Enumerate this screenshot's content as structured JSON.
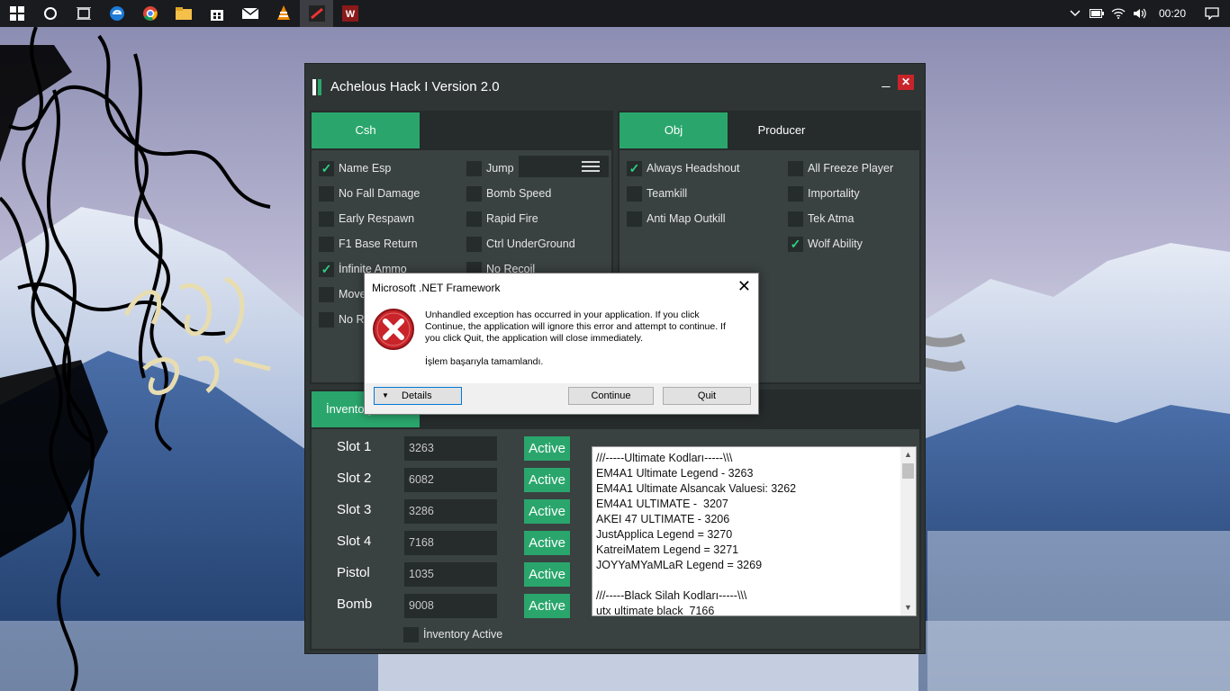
{
  "taskbar": {
    "icons": [
      "windows-start-icon",
      "cortana-icon",
      "task-view-icon",
      "edge-icon",
      "chrome-icon",
      "file-explorer-icon",
      "store-icon",
      "mail-icon",
      "vlc-icon",
      "app-icon",
      "hack-app-icon"
    ],
    "tray_icons": [
      "chevron-up-icon",
      "battery-icon",
      "wifi-icon",
      "volume-icon"
    ],
    "time": "00:20"
  },
  "hack_window": {
    "title": "Achelous Hack I Version 2.0",
    "minimize": "_",
    "close": "✕",
    "accent": "#2aa66c",
    "left_panel": {
      "tab": "Csh",
      "col1": [
        {
          "label": "Name Esp",
          "checked": true
        },
        {
          "label": "No Fall Damage",
          "checked": false
        },
        {
          "label": "Early Respawn",
          "checked": false
        },
        {
          "label": "F1 Base Return",
          "checked": false
        },
        {
          "label": "İnfinite Ammo",
          "checked": true
        },
        {
          "label": "Move",
          "checked": false
        },
        {
          "label": "No R",
          "checked": false
        }
      ],
      "col2": [
        {
          "label": "Jump",
          "checked": false
        },
        {
          "label": "Bomb Speed",
          "checked": false
        },
        {
          "label": "Rapid Fire",
          "checked": false
        },
        {
          "label": "Ctrl UnderGround",
          "checked": false
        },
        {
          "label": "No Recoil",
          "checked": false
        }
      ]
    },
    "right_panel": {
      "tabs": [
        "Obj",
        "Producer"
      ],
      "col1": [
        {
          "label": "Always Headshout",
          "checked": true
        },
        {
          "label": "Teamkill",
          "checked": false
        },
        {
          "label": "Anti Map Outkill",
          "checked": false
        }
      ],
      "col2": [
        {
          "label": "All Freeze Player",
          "checked": false
        },
        {
          "label": "Importality",
          "checked": false
        },
        {
          "label": "Tek Atma",
          "checked": false
        },
        {
          "label": "Wolf Ability",
          "checked": true
        }
      ]
    },
    "inventory": {
      "tab": "İnventory",
      "slots": [
        {
          "label": "Slot 1",
          "value": "3263",
          "button": "Active"
        },
        {
          "label": "Slot 2",
          "value": "6082",
          "button": "Active"
        },
        {
          "label": "Slot 3",
          "value": "3286",
          "button": "Active"
        },
        {
          "label": "Slot 4",
          "value": "7168",
          "button": "Active"
        },
        {
          "label": "Pistol",
          "value": "1035",
          "button": "Active"
        },
        {
          "label": "Bomb",
          "value": "9008",
          "button": "Active"
        }
      ],
      "inventory_active": "İnventory Active",
      "codes": [
        "///-----Ultimate Kodları-----\\\\\\",
        "EM4A1 Ultimate Legend - 3263",
        "EM4A1 Ultimate Alsancak Valuesi: 3262",
        "EM4A1 ULTIMATE -  3207",
        "AKEI 47 ULTIMATE - 3206",
        "JustApplica Legend = 3270",
        "KatreiMatem Legend = 3271",
        "JOYYaMYaMLaR Legend = 3269",
        "",
        "///-----Black Silah Kodları-----\\\\\\",
        "utx ultimate black  7166"
      ]
    }
  },
  "dialog": {
    "title": "Microsoft .NET Framework",
    "message": "Unhandled exception has occurred in your application. If you click Continue, the application will ignore this error and attempt to continue. If you click Quit, the application will close immediately.",
    "message2": "İşlem başarıyla tamamlandı.",
    "details": "Details",
    "continue": "Continue",
    "quit": "Quit"
  }
}
